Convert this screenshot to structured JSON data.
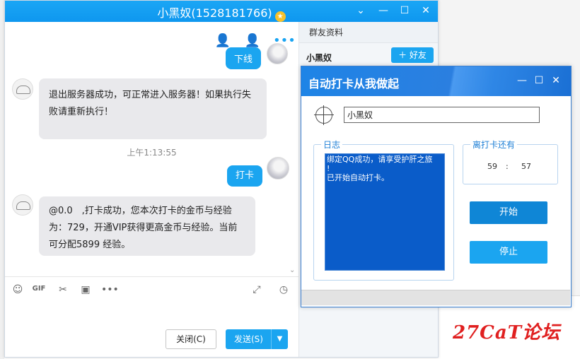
{
  "qq_window": {
    "title": "小黑奴(1528181766)",
    "chat": {
      "msg_out_1": "下线",
      "msg_in_1": "退出服务器成功，可正常进入服务器！如果执行失败请重新执行！",
      "timestamp": "上午1:13:55",
      "msg_out_2": "打卡",
      "msg_in_2": "@0.0　,打卡成功，您本次打卡的金币与经验为：729，开通VIP获得更高金币与经验。当前可分配5899 经验。"
    },
    "buttons": {
      "close": "关闭(C)",
      "send": "发送(S)"
    },
    "side_panel": {
      "header": "群友资料",
      "name": "小黑奴",
      "add_friend": "好友"
    }
  },
  "dialog": {
    "title": "自动打卡从我做起",
    "name_value": "小黑奴",
    "log_legend": "日志",
    "log_lines": [
      "绑定QQ成功，请享受护肝之旅",
      "!",
      "已开始自动打卡。"
    ],
    "countdown_legend": "离打卡还有",
    "countdown_min": "59",
    "countdown_sep": ":",
    "countdown_sec": "57",
    "start_label": "开始",
    "stop_label": "停止"
  },
  "watermark": "27CaT论坛",
  "colors": {
    "qq_blue": "#1ba5f0",
    "log_blue": "#0a5cc9",
    "watermark_red": "#e02020"
  }
}
